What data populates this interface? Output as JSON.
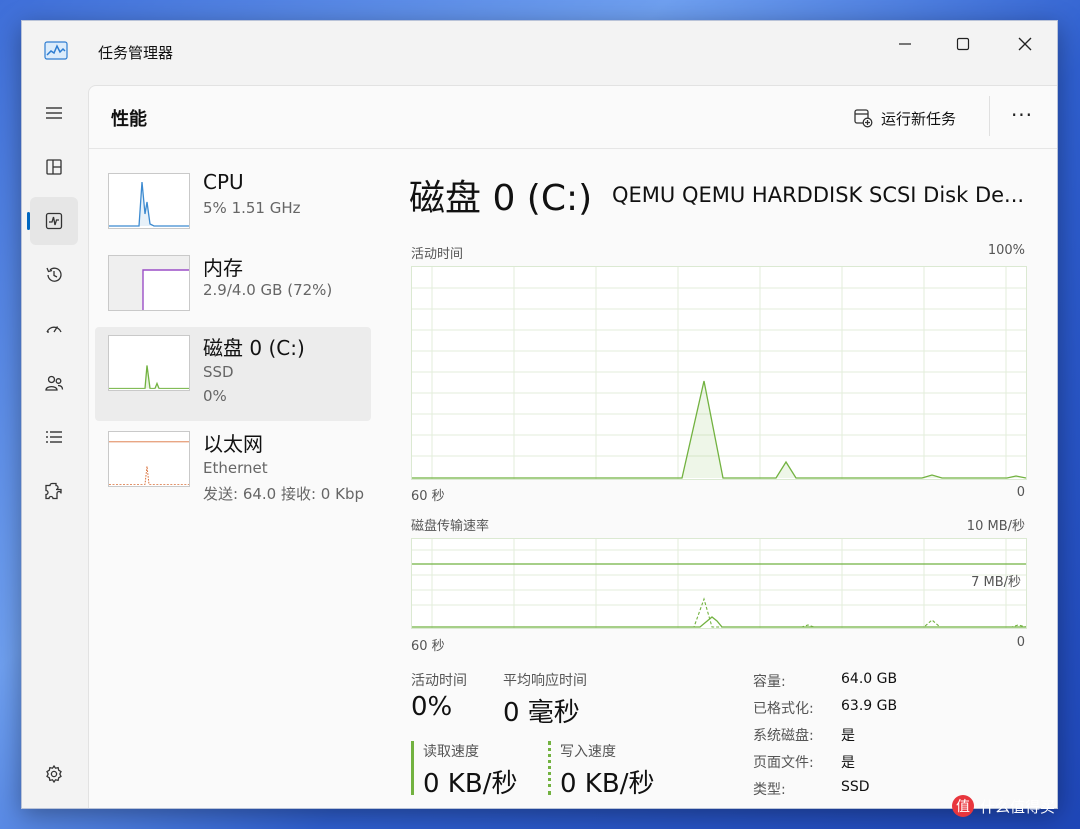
{
  "window": {
    "title": "任务管理器"
  },
  "header": {
    "page_title": "性能",
    "run_task_label": "运行新任务",
    "more_label": "···"
  },
  "devices": [
    {
      "name": "CPU",
      "sub1": "5% 1.51 GHz",
      "sub2": "",
      "color": "#3c8ad0"
    },
    {
      "name": "内存",
      "sub1": "2.9/4.0 GB (72%)",
      "sub2": "",
      "color": "#9b4fc7"
    },
    {
      "name": "磁盘 0 (C:)",
      "sub1": "SSD",
      "sub2": "0%",
      "color": "#72b240"
    },
    {
      "name": "以太网",
      "sub1": "Ethernet",
      "sub2": "发送: 64.0 接收: 0 Kbp",
      "color": "#d9703a"
    }
  ],
  "detail": {
    "title": "磁盘 0 (C:)",
    "model": "QEMU QEMU HARDDISK SCSI Disk De...",
    "activity_graph": {
      "label": "活动时间",
      "max_label": "100%",
      "time_label": "60 秒",
      "min_label": "0"
    },
    "transfer_graph": {
      "label": "磁盘传输速率",
      "max_label": "10 MB/秒",
      "mid_label": "7 MB/秒",
      "time_label": "60 秒",
      "min_label": "0"
    },
    "stats": {
      "active_time_label": "活动时间",
      "active_time_value": "0%",
      "avg_response_label": "平均响应时间",
      "avg_response_value": "0 毫秒",
      "read_label": "读取速度",
      "read_value": "0 KB/秒",
      "write_label": "写入速度",
      "write_value": "0 KB/秒"
    },
    "properties": [
      {
        "label": "容量:",
        "value": "64.0 GB"
      },
      {
        "label": "已格式化:",
        "value": "63.9 GB"
      },
      {
        "label": "系统磁盘:",
        "value": "是"
      },
      {
        "label": "页面文件:",
        "value": "是"
      },
      {
        "label": "类型:",
        "value": "SSD"
      }
    ]
  },
  "watermark": {
    "badge": "值",
    "text": "什么值得买"
  },
  "colors": {
    "accent": "#0067c0",
    "disk_green": "#72b240",
    "cpu_blue": "#3c8ad0",
    "memory_purple": "#9b4fc7",
    "network_orange": "#d9703a"
  },
  "rail_icons": [
    "menu-icon",
    "processes-icon",
    "performance-icon",
    "app-history-icon",
    "startup-icon",
    "users-icon",
    "details-icon",
    "services-icon",
    "settings-icon"
  ]
}
